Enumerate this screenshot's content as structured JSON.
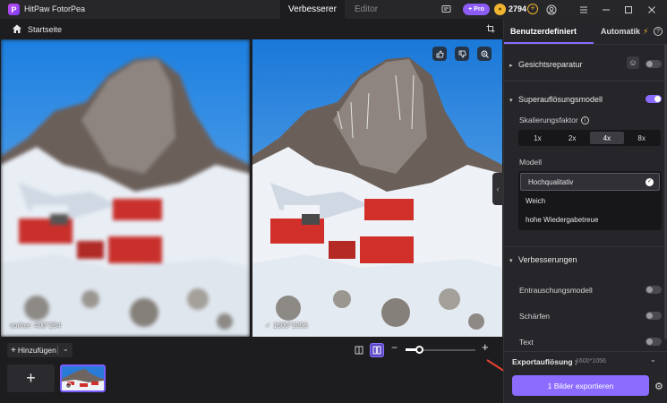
{
  "app": {
    "title": "HitPaw FotorPea",
    "logo_letter": "P",
    "tabs": [
      {
        "label": "Verbesserer",
        "active": true
      },
      {
        "label": "Editor",
        "active": false
      }
    ],
    "pro_label": "+ Pro",
    "coins": "2794"
  },
  "subheader": {
    "home_label": "Startseite"
  },
  "preview": {
    "before_label": "vorher: 400*264",
    "after_label": "1600*1056"
  },
  "bottom": {
    "add_label": "Hinzufügen",
    "zoom_percent": 20
  },
  "panel": {
    "tabs": [
      {
        "label": "Benutzerdefiniert",
        "active": true
      },
      {
        "label": "Automatik",
        "active": false
      }
    ],
    "sections": {
      "face": {
        "title": "Gesichtsreparatur",
        "enabled": false
      },
      "superres": {
        "title": "Superauflösungsmodell",
        "enabled": true,
        "scale_label": "Skalierungsfaktor",
        "scale_options": [
          "1x",
          "2x",
          "4x",
          "8x"
        ],
        "scale_selected": "4x",
        "model_label": "Modell",
        "models": [
          "Hochqualitativ",
          "Weich",
          "hohe Wiedergabetreue"
        ],
        "model_selected": "Hochqualitativ"
      },
      "enhance": {
        "title": "Verbesserungen",
        "options": [
          {
            "label": "Entrauschungsmodell",
            "enabled": false
          },
          {
            "label": "Schärfen",
            "enabled": false
          },
          {
            "label": "Text",
            "enabled": false
          }
        ]
      }
    },
    "export_res_label": "Exportauflösung :",
    "export_res_value": "1600*1056",
    "export_button": "1 Bilder exportieren"
  },
  "colors": {
    "accent": "#8b6cff",
    "coin": "#f2b531",
    "background": "#1d1d20"
  }
}
